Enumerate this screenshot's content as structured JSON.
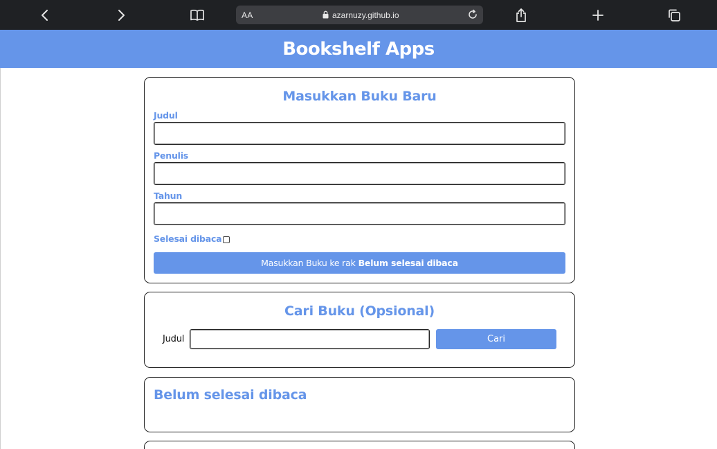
{
  "browser": {
    "aa_label": "AA",
    "url": "azarnuzy.github.io"
  },
  "app": {
    "title": "Bookshelf Apps"
  },
  "input_section": {
    "title": "Masukkan Buku Baru",
    "title_label": "Judul",
    "title_value": "",
    "author_label": "Penulis",
    "author_value": "",
    "year_label": "Tahun",
    "year_value": "",
    "complete_label": "Selesai dibaca",
    "complete_checked": false,
    "submit_prefix": "Masukkan Buku ke rak",
    "submit_shelf": "Belum selesai dibaca"
  },
  "search_section": {
    "title": "Cari Buku (Opsional)",
    "label": "Judul",
    "value": "",
    "button": "Cari"
  },
  "shelves": {
    "incomplete_title": "Belum selesai dibaca"
  },
  "colors": {
    "accent": "#6595e9",
    "toolbar": "#1f2124"
  }
}
